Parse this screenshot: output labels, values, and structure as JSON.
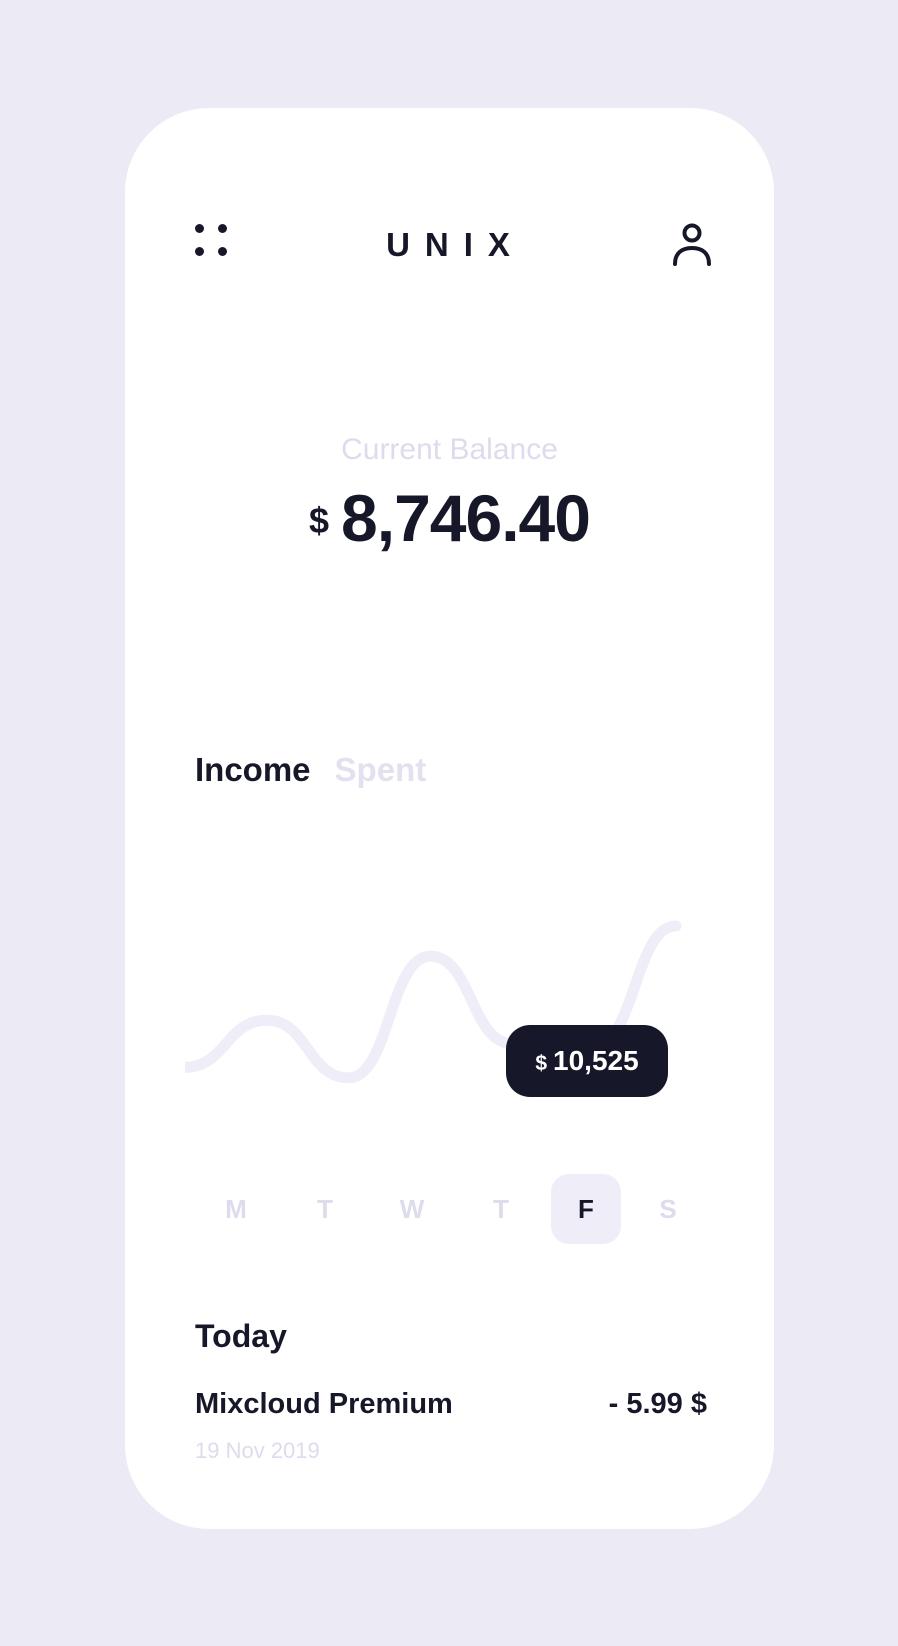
{
  "header": {
    "title": "UNIX",
    "menu_icon": "grid-dots-icon",
    "profile_icon": "user-icon"
  },
  "balance": {
    "label": "Current Balance",
    "currency": "$",
    "value": "8,746.40"
  },
  "tabs": [
    {
      "label": "Income",
      "active": true
    },
    {
      "label": "Spent",
      "active": false
    }
  ],
  "chart_data": {
    "type": "line",
    "series": [
      {
        "values": [
          0.12,
          0.48,
          0.04,
          0.97,
          0.3,
          0.29,
          1.2
        ]
      }
    ],
    "highlight_point_index": 5,
    "highlight_label": {
      "currency": "$",
      "value": "10,525"
    }
  },
  "days": [
    {
      "label": "M",
      "active": false
    },
    {
      "label": "T",
      "active": false
    },
    {
      "label": "W",
      "active": false
    },
    {
      "label": "T",
      "active": false
    },
    {
      "label": "F",
      "active": true
    },
    {
      "label": "S",
      "active": false
    }
  ],
  "transactions": {
    "section_title": "Today",
    "items": [
      {
        "name": "Mixcloud Premium",
        "amount": "- 5.99 $",
        "date": "19 Nov 2019"
      }
    ]
  },
  "colors": {
    "background": "#ebeaf5",
    "card": "#ffffff",
    "primary": "#161829",
    "muted": "#dcdcec",
    "curve": "#efeef8"
  }
}
